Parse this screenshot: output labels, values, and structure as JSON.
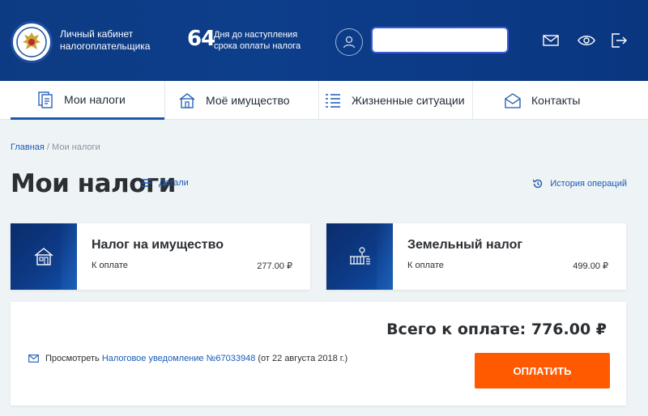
{
  "header": {
    "brand_line1": "Личный кабинет",
    "brand_line2": "налогоплательщика",
    "days_number": "64",
    "days_line1": "Дня до наступления",
    "days_line2": "срока оплаты налога",
    "username": "",
    "icons": [
      "mail-icon",
      "eye-icon",
      "logout-icon"
    ]
  },
  "tabs": [
    {
      "label": "Мои налоги",
      "icon": "documents-icon",
      "active": true
    },
    {
      "label": "Моё имущество",
      "icon": "house-icon",
      "active": false
    },
    {
      "label": "Жизненные ситуации",
      "icon": "list-icon",
      "active": false
    },
    {
      "label": "Контакты",
      "icon": "envelope-icon",
      "active": false
    }
  ],
  "breadcrumb": {
    "home": "Главная",
    "separator": " / ",
    "current": "Мои налоги"
  },
  "page": {
    "title": "Мои налоги",
    "details_label": "Детали",
    "history_label": "История операций"
  },
  "cards": [
    {
      "title": "Налог на имущество",
      "label": "К оплате",
      "amount": "277.00 ₽",
      "icon": "house-icon"
    },
    {
      "title": "Земельный налог",
      "label": "К оплате",
      "amount": "499.00 ₽",
      "icon": "land-icon"
    }
  ],
  "summary": {
    "total": "Всего к оплате: 776.00 ₽",
    "notice_prefix": "Просмотреть",
    "notice_link": "Налоговое уведомление №67033948",
    "notice_suffix": "(от 22 августа 2018 г.)",
    "pay_label": "ОПЛАТИТЬ"
  },
  "colors": {
    "header": "#0d3b83",
    "accent": "#1b58b3",
    "pay": "#ff5a00"
  }
}
